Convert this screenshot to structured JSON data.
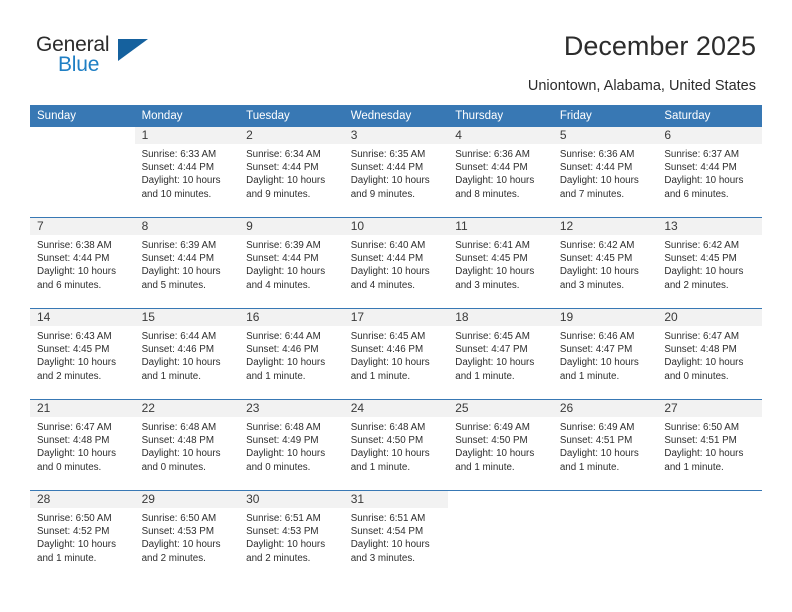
{
  "brand": {
    "name_part1": "General",
    "name_part2": "Blue",
    "accent_color": "#1f7fc4",
    "flag_color": "#15619e"
  },
  "header": {
    "title": "December 2025",
    "location": "Uniontown, Alabama, United States"
  },
  "calendar": {
    "header_bg": "#3878b4",
    "daynum_bg": "#f2f2f2",
    "weekday_headers": [
      "Sunday",
      "Monday",
      "Tuesday",
      "Wednesday",
      "Thursday",
      "Friday",
      "Saturday"
    ],
    "labels": {
      "sunrise_prefix": "Sunrise:",
      "sunset_prefix": "Sunset:",
      "daylight_prefix": "Daylight:"
    },
    "weeks": [
      [
        {
          "day": "",
          "sunrise": "",
          "sunset": "",
          "daylight_line1": "",
          "daylight_line2": "",
          "blank": true
        },
        {
          "day": "1",
          "sunrise": "Sunrise: 6:33 AM",
          "sunset": "Sunset: 4:44 PM",
          "daylight_line1": "Daylight: 10 hours",
          "daylight_line2": "and 10 minutes."
        },
        {
          "day": "2",
          "sunrise": "Sunrise: 6:34 AM",
          "sunset": "Sunset: 4:44 PM",
          "daylight_line1": "Daylight: 10 hours",
          "daylight_line2": "and 9 minutes."
        },
        {
          "day": "3",
          "sunrise": "Sunrise: 6:35 AM",
          "sunset": "Sunset: 4:44 PM",
          "daylight_line1": "Daylight: 10 hours",
          "daylight_line2": "and 9 minutes."
        },
        {
          "day": "4",
          "sunrise": "Sunrise: 6:36 AM",
          "sunset": "Sunset: 4:44 PM",
          "daylight_line1": "Daylight: 10 hours",
          "daylight_line2": "and 8 minutes."
        },
        {
          "day": "5",
          "sunrise": "Sunrise: 6:36 AM",
          "sunset": "Sunset: 4:44 PM",
          "daylight_line1": "Daylight: 10 hours",
          "daylight_line2": "and 7 minutes."
        },
        {
          "day": "6",
          "sunrise": "Sunrise: 6:37 AM",
          "sunset": "Sunset: 4:44 PM",
          "daylight_line1": "Daylight: 10 hours",
          "daylight_line2": "and 6 minutes."
        }
      ],
      [
        {
          "day": "7",
          "sunrise": "Sunrise: 6:38 AM",
          "sunset": "Sunset: 4:44 PM",
          "daylight_line1": "Daylight: 10 hours",
          "daylight_line2": "and 6 minutes."
        },
        {
          "day": "8",
          "sunrise": "Sunrise: 6:39 AM",
          "sunset": "Sunset: 4:44 PM",
          "daylight_line1": "Daylight: 10 hours",
          "daylight_line2": "and 5 minutes."
        },
        {
          "day": "9",
          "sunrise": "Sunrise: 6:39 AM",
          "sunset": "Sunset: 4:44 PM",
          "daylight_line1": "Daylight: 10 hours",
          "daylight_line2": "and 4 minutes."
        },
        {
          "day": "10",
          "sunrise": "Sunrise: 6:40 AM",
          "sunset": "Sunset: 4:44 PM",
          "daylight_line1": "Daylight: 10 hours",
          "daylight_line2": "and 4 minutes."
        },
        {
          "day": "11",
          "sunrise": "Sunrise: 6:41 AM",
          "sunset": "Sunset: 4:45 PM",
          "daylight_line1": "Daylight: 10 hours",
          "daylight_line2": "and 3 minutes."
        },
        {
          "day": "12",
          "sunrise": "Sunrise: 6:42 AM",
          "sunset": "Sunset: 4:45 PM",
          "daylight_line1": "Daylight: 10 hours",
          "daylight_line2": "and 3 minutes."
        },
        {
          "day": "13",
          "sunrise": "Sunrise: 6:42 AM",
          "sunset": "Sunset: 4:45 PM",
          "daylight_line1": "Daylight: 10 hours",
          "daylight_line2": "and 2 minutes."
        }
      ],
      [
        {
          "day": "14",
          "sunrise": "Sunrise: 6:43 AM",
          "sunset": "Sunset: 4:45 PM",
          "daylight_line1": "Daylight: 10 hours",
          "daylight_line2": "and 2 minutes."
        },
        {
          "day": "15",
          "sunrise": "Sunrise: 6:44 AM",
          "sunset": "Sunset: 4:46 PM",
          "daylight_line1": "Daylight: 10 hours",
          "daylight_line2": "and 1 minute."
        },
        {
          "day": "16",
          "sunrise": "Sunrise: 6:44 AM",
          "sunset": "Sunset: 4:46 PM",
          "daylight_line1": "Daylight: 10 hours",
          "daylight_line2": "and 1 minute."
        },
        {
          "day": "17",
          "sunrise": "Sunrise: 6:45 AM",
          "sunset": "Sunset: 4:46 PM",
          "daylight_line1": "Daylight: 10 hours",
          "daylight_line2": "and 1 minute."
        },
        {
          "day": "18",
          "sunrise": "Sunrise: 6:45 AM",
          "sunset": "Sunset: 4:47 PM",
          "daylight_line1": "Daylight: 10 hours",
          "daylight_line2": "and 1 minute."
        },
        {
          "day": "19",
          "sunrise": "Sunrise: 6:46 AM",
          "sunset": "Sunset: 4:47 PM",
          "daylight_line1": "Daylight: 10 hours",
          "daylight_line2": "and 1 minute."
        },
        {
          "day": "20",
          "sunrise": "Sunrise: 6:47 AM",
          "sunset": "Sunset: 4:48 PM",
          "daylight_line1": "Daylight: 10 hours",
          "daylight_line2": "and 0 minutes."
        }
      ],
      [
        {
          "day": "21",
          "sunrise": "Sunrise: 6:47 AM",
          "sunset": "Sunset: 4:48 PM",
          "daylight_line1": "Daylight: 10 hours",
          "daylight_line2": "and 0 minutes."
        },
        {
          "day": "22",
          "sunrise": "Sunrise: 6:48 AM",
          "sunset": "Sunset: 4:48 PM",
          "daylight_line1": "Daylight: 10 hours",
          "daylight_line2": "and 0 minutes."
        },
        {
          "day": "23",
          "sunrise": "Sunrise: 6:48 AM",
          "sunset": "Sunset: 4:49 PM",
          "daylight_line1": "Daylight: 10 hours",
          "daylight_line2": "and 0 minutes."
        },
        {
          "day": "24",
          "sunrise": "Sunrise: 6:48 AM",
          "sunset": "Sunset: 4:50 PM",
          "daylight_line1": "Daylight: 10 hours",
          "daylight_line2": "and 1 minute."
        },
        {
          "day": "25",
          "sunrise": "Sunrise: 6:49 AM",
          "sunset": "Sunset: 4:50 PM",
          "daylight_line1": "Daylight: 10 hours",
          "daylight_line2": "and 1 minute."
        },
        {
          "day": "26",
          "sunrise": "Sunrise: 6:49 AM",
          "sunset": "Sunset: 4:51 PM",
          "daylight_line1": "Daylight: 10 hours",
          "daylight_line2": "and 1 minute."
        },
        {
          "day": "27",
          "sunrise": "Sunrise: 6:50 AM",
          "sunset": "Sunset: 4:51 PM",
          "daylight_line1": "Daylight: 10 hours",
          "daylight_line2": "and 1 minute."
        }
      ],
      [
        {
          "day": "28",
          "sunrise": "Sunrise: 6:50 AM",
          "sunset": "Sunset: 4:52 PM",
          "daylight_line1": "Daylight: 10 hours",
          "daylight_line2": "and 1 minute."
        },
        {
          "day": "29",
          "sunrise": "Sunrise: 6:50 AM",
          "sunset": "Sunset: 4:53 PM",
          "daylight_line1": "Daylight: 10 hours",
          "daylight_line2": "and 2 minutes."
        },
        {
          "day": "30",
          "sunrise": "Sunrise: 6:51 AM",
          "sunset": "Sunset: 4:53 PM",
          "daylight_line1": "Daylight: 10 hours",
          "daylight_line2": "and 2 minutes."
        },
        {
          "day": "31",
          "sunrise": "Sunrise: 6:51 AM",
          "sunset": "Sunset: 4:54 PM",
          "daylight_line1": "Daylight: 10 hours",
          "daylight_line2": "and 3 minutes."
        },
        {
          "day": "",
          "sunrise": "",
          "sunset": "",
          "daylight_line1": "",
          "daylight_line2": "",
          "blank": true
        },
        {
          "day": "",
          "sunrise": "",
          "sunset": "",
          "daylight_line1": "",
          "daylight_line2": "",
          "blank": true
        },
        {
          "day": "",
          "sunrise": "",
          "sunset": "",
          "daylight_line1": "",
          "daylight_line2": "",
          "blank": true
        }
      ]
    ]
  }
}
